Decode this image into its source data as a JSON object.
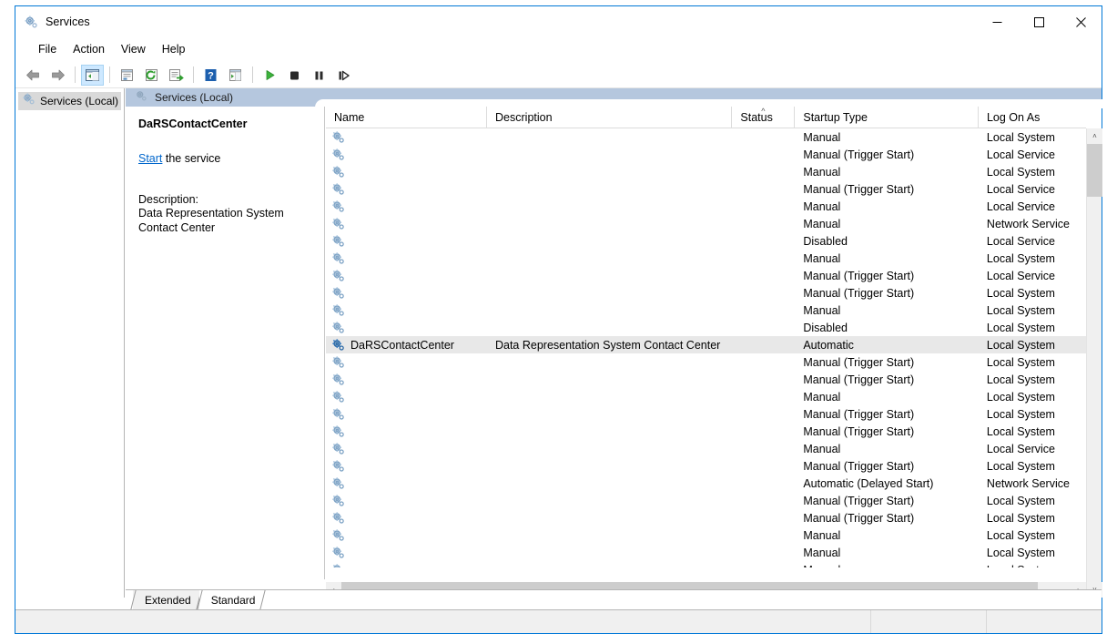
{
  "window": {
    "title": "Services",
    "title_icon": "services-gear-icon",
    "minimize_label": "—",
    "maximize_label": "☐",
    "close_label": "✕",
    "border_color": "#0078d7"
  },
  "menubar": {
    "items": [
      {
        "label": "File"
      },
      {
        "label": "Action"
      },
      {
        "label": "View"
      },
      {
        "label": "Help"
      }
    ]
  },
  "toolbar": {
    "buttons": [
      {
        "name": "back-arrow-icon",
        "tooltip": "Back"
      },
      {
        "name": "forward-arrow-icon",
        "tooltip": "Forward"
      },
      {
        "name": "show-hide-tree-icon",
        "tooltip": "Show/Hide Console Tree",
        "active": true
      },
      {
        "name": "properties-icon",
        "tooltip": "Properties"
      },
      {
        "name": "refresh-icon",
        "tooltip": "Refresh"
      },
      {
        "name": "export-list-icon",
        "tooltip": "Export List"
      },
      {
        "name": "help-icon",
        "tooltip": "Help"
      },
      {
        "name": "show-action-pane-icon",
        "tooltip": "Show/Hide Action Pane"
      },
      {
        "name": "start-service-icon",
        "tooltip": "Start Service"
      },
      {
        "name": "stop-service-icon",
        "tooltip": "Stop Service"
      },
      {
        "name": "pause-service-icon",
        "tooltip": "Pause Service"
      },
      {
        "name": "restart-service-icon",
        "tooltip": "Restart Service"
      }
    ]
  },
  "tree": {
    "root_label": "Services (Local)",
    "root_icon": "services-gear-icon"
  },
  "pane_header": {
    "label": "Services (Local)",
    "icon": "services-gear-icon",
    "background": "#b5c7de"
  },
  "detail": {
    "service_name": "DaRSContactCenter",
    "action_link": "Start",
    "action_suffix": " the service",
    "description_label": "Description:",
    "description_text": "Data Representation System Contact Center"
  },
  "list": {
    "columns": [
      {
        "key": "name",
        "label": "Name",
        "sorted": false
      },
      {
        "key": "desc",
        "label": "Description",
        "sorted": false
      },
      {
        "key": "status",
        "label": "Status",
        "sorted": true,
        "sort_direction": "asc"
      },
      {
        "key": "start",
        "label": "Startup Type",
        "sorted": false
      },
      {
        "key": "logon",
        "label": "Log On As",
        "sorted": false
      }
    ],
    "selected_index": 12,
    "rows": [
      {
        "name": "",
        "desc": "",
        "status": "",
        "start": "Manual",
        "logon": "Local System",
        "icon": "service-gear-icon"
      },
      {
        "name": "",
        "desc": "",
        "status": "",
        "start": "Manual (Trigger Start)",
        "logon": "Local Service",
        "icon": "service-gear-icon"
      },
      {
        "name": "",
        "desc": "",
        "status": "",
        "start": "Manual",
        "logon": "Local System",
        "icon": "service-gear-icon"
      },
      {
        "name": "",
        "desc": "",
        "status": "",
        "start": "Manual (Trigger Start)",
        "logon": "Local Service",
        "icon": "service-gear-icon"
      },
      {
        "name": "",
        "desc": "",
        "status": "",
        "start": "Manual",
        "logon": "Local Service",
        "icon": "service-gear-icon"
      },
      {
        "name": "",
        "desc": "",
        "status": "",
        "start": "Manual",
        "logon": "Network Service",
        "icon": "service-gear-icon"
      },
      {
        "name": "",
        "desc": "",
        "status": "",
        "start": "Disabled",
        "logon": "Local Service",
        "icon": "service-gear-icon"
      },
      {
        "name": "",
        "desc": "",
        "status": "",
        "start": "Manual",
        "logon": "Local System",
        "icon": "service-gear-icon"
      },
      {
        "name": "",
        "desc": "",
        "status": "",
        "start": "Manual (Trigger Start)",
        "logon": "Local Service",
        "icon": "service-gear-icon"
      },
      {
        "name": "",
        "desc": "",
        "status": "",
        "start": "Manual (Trigger Start)",
        "logon": "Local System",
        "icon": "service-gear-icon"
      },
      {
        "name": "",
        "desc": "",
        "status": "",
        "start": "Manual",
        "logon": "Local System",
        "icon": "service-gear-icon"
      },
      {
        "name": "",
        "desc": "",
        "status": "",
        "start": "Disabled",
        "logon": "Local System",
        "icon": "service-gear-icon"
      },
      {
        "name": "DaRSContactCenter",
        "desc": "Data Representation System Contact Center",
        "status": "",
        "start": "Automatic",
        "logon": "Local System",
        "icon": "service-gear-icon-selected"
      },
      {
        "name": "",
        "desc": "",
        "status": "",
        "start": "Manual (Trigger Start)",
        "logon": "Local System",
        "icon": "service-gear-icon"
      },
      {
        "name": "",
        "desc": "",
        "status": "",
        "start": "Manual (Trigger Start)",
        "logon": "Local System",
        "icon": "service-gear-icon"
      },
      {
        "name": "",
        "desc": "",
        "status": "",
        "start": "Manual",
        "logon": "Local System",
        "icon": "service-gear-icon"
      },
      {
        "name": "",
        "desc": "",
        "status": "",
        "start": "Manual (Trigger Start)",
        "logon": "Local System",
        "icon": "service-gear-icon"
      },
      {
        "name": "",
        "desc": "",
        "status": "",
        "start": "Manual (Trigger Start)",
        "logon": "Local System",
        "icon": "service-gear-icon"
      },
      {
        "name": "",
        "desc": "",
        "status": "",
        "start": "Manual",
        "logon": "Local Service",
        "icon": "service-gear-icon"
      },
      {
        "name": "",
        "desc": "",
        "status": "",
        "start": "Manual (Trigger Start)",
        "logon": "Local System",
        "icon": "service-gear-icon"
      },
      {
        "name": "",
        "desc": "",
        "status": "",
        "start": "Automatic (Delayed Start)",
        "logon": "Network Service",
        "icon": "service-gear-icon"
      },
      {
        "name": "",
        "desc": "",
        "status": "",
        "start": "Manual (Trigger Start)",
        "logon": "Local System",
        "icon": "service-gear-icon"
      },
      {
        "name": "",
        "desc": "",
        "status": "",
        "start": "Manual (Trigger Start)",
        "logon": "Local System",
        "icon": "service-gear-icon"
      },
      {
        "name": "",
        "desc": "",
        "status": "",
        "start": "Manual",
        "logon": "Local System",
        "icon": "service-gear-icon"
      },
      {
        "name": "",
        "desc": "",
        "status": "",
        "start": "Manual",
        "logon": "Local System",
        "icon": "service-gear-icon"
      },
      {
        "name": "",
        "desc": "",
        "status": "",
        "start": "Manual",
        "logon": "Local System",
        "icon": "service-gear-icon"
      }
    ]
  },
  "scrollbars": {
    "vertical_up_glyph": "˄",
    "vertical_down_glyph": "˅",
    "horizontal_left_glyph": "‹",
    "horizontal_right_glyph": "›"
  },
  "tabs": [
    {
      "label": "Extended",
      "active": false
    },
    {
      "label": "Standard",
      "active": true
    }
  ],
  "statusbar": {
    "text": "",
    "sections": 2
  }
}
